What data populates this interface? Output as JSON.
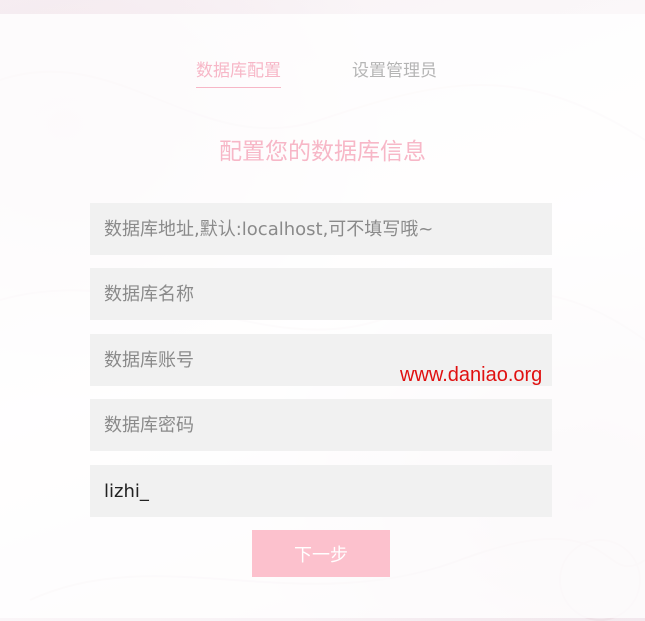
{
  "tabs": {
    "db_config": "数据库配置",
    "admin_setup": "设置管理员"
  },
  "heading": "配置您的数据库信息",
  "form": {
    "host_placeholder": "数据库地址,默认:localhost,可不填写哦~",
    "name_placeholder": "数据库名称",
    "user_placeholder": "数据库账号",
    "password_placeholder": "数据库密码",
    "prefix_value": "lizhi_"
  },
  "watermark": "www.daniao.org",
  "next_button": "下一步",
  "colors": {
    "accent": "#f7b7c7",
    "button": "#fcc1cd",
    "field_bg": "#f1f1f1",
    "watermark": "#e01010"
  }
}
